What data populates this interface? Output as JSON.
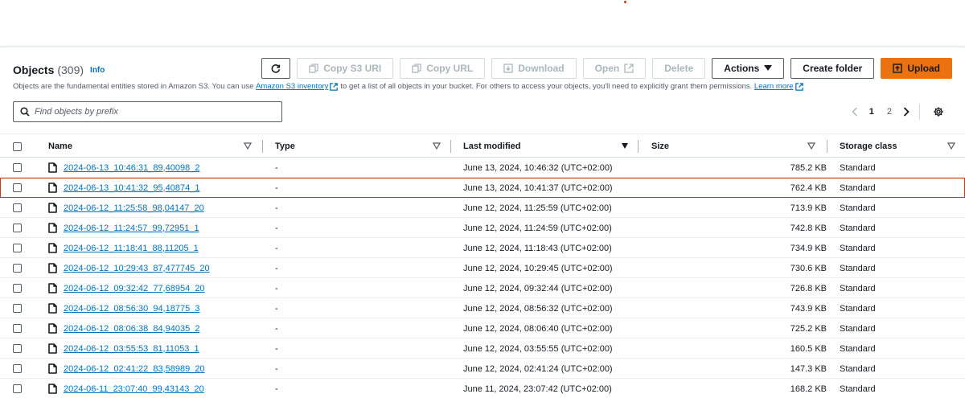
{
  "header": {
    "title": "Objects",
    "count": "(309)",
    "info": "Info"
  },
  "toolbar": {
    "copy_s3_uri": "Copy S3 URI",
    "copy_url": "Copy URL",
    "download": "Download",
    "open": "Open",
    "delete": "Delete",
    "actions": "Actions",
    "create_folder": "Create folder",
    "upload": "Upload"
  },
  "description": {
    "text_before": "Objects are the fundamental entities stored in Amazon S3. You can use",
    "inventory_link": "Amazon S3 inventory",
    "text_middle": "to get a list of all objects in your bucket. For others to access your objects, you'll need to explicitly grant them permissions.",
    "learn_more": "Learn more"
  },
  "search": {
    "placeholder": "Find objects by prefix",
    "value": ""
  },
  "pagination": {
    "pages": [
      "1",
      "2"
    ],
    "current": "1"
  },
  "table": {
    "columns": [
      "Name",
      "Type",
      "Last modified",
      "Size",
      "Storage class"
    ],
    "rows": [
      {
        "name": "2024-06-13_10:46:31_89,40098_2",
        "type": "-",
        "modified": "June 13, 2024, 10:46:32 (UTC+02:00)",
        "size": "785.2 KB",
        "storage": "Standard"
      },
      {
        "name": "2024-06-13_10:41:32_95,40874_1",
        "type": "-",
        "modified": "June 13, 2024, 10:41:37 (UTC+02:00)",
        "size": "762.4 KB",
        "storage": "Standard"
      },
      {
        "name": "2024-06-12_11:25:58_98,04147_20",
        "type": "-",
        "modified": "June 12, 2024, 11:25:59 (UTC+02:00)",
        "size": "713.9 KB",
        "storage": "Standard"
      },
      {
        "name": "2024-06-12_11:24:57_99,72951_1",
        "type": "-",
        "modified": "June 12, 2024, 11:24:59 (UTC+02:00)",
        "size": "742.8 KB",
        "storage": "Standard"
      },
      {
        "name": "2024-06-12_11:18:41_88,11205_1",
        "type": "-",
        "modified": "June 12, 2024, 11:18:43 (UTC+02:00)",
        "size": "734.9 KB",
        "storage": "Standard"
      },
      {
        "name": "2024-06-12_10:29:43_87,477745_20",
        "type": "-",
        "modified": "June 12, 2024, 10:29:45 (UTC+02:00)",
        "size": "730.6 KB",
        "storage": "Standard"
      },
      {
        "name": "2024-06-12_09:32:42_77,68954_20",
        "type": "-",
        "modified": "June 12, 2024, 09:32:44 (UTC+02:00)",
        "size": "726.8 KB",
        "storage": "Standard"
      },
      {
        "name": "2024-06-12_08:56:30_94,18775_3",
        "type": "-",
        "modified": "June 12, 2024, 08:56:32 (UTC+02:00)",
        "size": "743.9 KB",
        "storage": "Standard"
      },
      {
        "name": "2024-06-12_08:06:38_84,94035_2",
        "type": "-",
        "modified": "June 12, 2024, 08:06:40 (UTC+02:00)",
        "size": "725.2 KB",
        "storage": "Standard"
      },
      {
        "name": "2024-06-12_03:55:53_81,11053_1",
        "type": "-",
        "modified": "June 12, 2024, 03:55:55 (UTC+02:00)",
        "size": "160.5 KB",
        "storage": "Standard"
      },
      {
        "name": "2024-06-12_02:41:22_83,58989_20",
        "type": "-",
        "modified": "June 12, 2024, 02:41:24 (UTC+02:00)",
        "size": "147.3 KB",
        "storage": "Standard"
      },
      {
        "name": "2024-06-11_23:07:40_99,43143_20",
        "type": "-",
        "modified": "June 11, 2024, 23:07:42 (UTC+02:00)",
        "size": "168.2 KB",
        "storage": "Standard"
      }
    ]
  },
  "colors": {
    "link": "#0073bb",
    "primary": "#ec7211",
    "highlight": "#d13212",
    "text": "#16191f",
    "muted": "#545b64"
  },
  "icons": [
    "refresh-icon",
    "copy-icon",
    "download-icon",
    "external-link-icon",
    "caret-down-icon",
    "upload-icon",
    "search-icon",
    "chevron-left-icon",
    "chevron-right-icon",
    "settings-gear-icon",
    "sort-icon",
    "file-icon"
  ]
}
